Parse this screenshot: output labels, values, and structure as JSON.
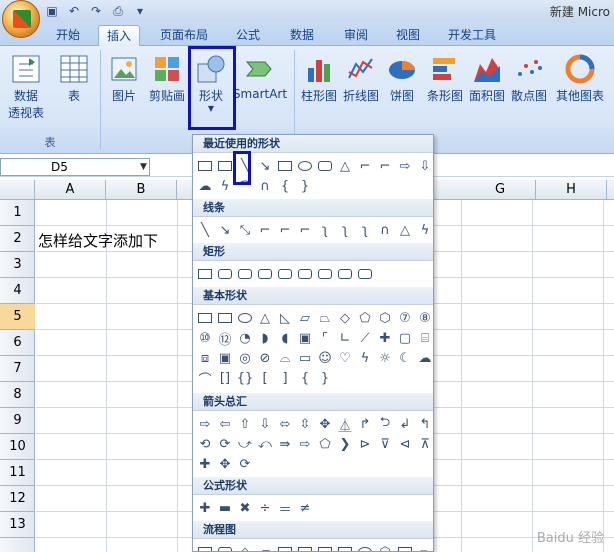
{
  "titlebar": {
    "app_title": "新建 Micro"
  },
  "tabs": [
    "开始",
    "插入",
    "页面布局",
    "公式",
    "数据",
    "审阅",
    "视图",
    "开发工具"
  ],
  "ribbon": {
    "pivot": "数据\n透视表",
    "pivot_line1": "数据",
    "pivot_line2": "透视表",
    "table": "表",
    "picture": "图片",
    "clipart": "剪贴画",
    "shapes": "形状",
    "smartart": "SmartArt",
    "column": "柱形图",
    "line": "折线图",
    "pie": "饼图",
    "bar": "条形图",
    "area": "面积图",
    "scatter": "散点图",
    "other": "其他图表",
    "group_table": "表"
  },
  "namebox": {
    "value": "D5"
  },
  "columns": [
    "A",
    "B",
    "G",
    "H"
  ],
  "rows": [
    "1",
    "2",
    "3",
    "4",
    "5",
    "6",
    "7",
    "8",
    "9",
    "10",
    "11",
    "12",
    "13"
  ],
  "cells": {
    "a2": "怎样给文字添加下"
  },
  "dropdown": {
    "recent": "最近使用的形状",
    "lines": "线条",
    "rect": "矩形",
    "basic": "基本形状",
    "arrows": "箭头总汇",
    "equation": "公式形状",
    "flowchart": "流程图"
  },
  "watermark": "Baidu 经验"
}
